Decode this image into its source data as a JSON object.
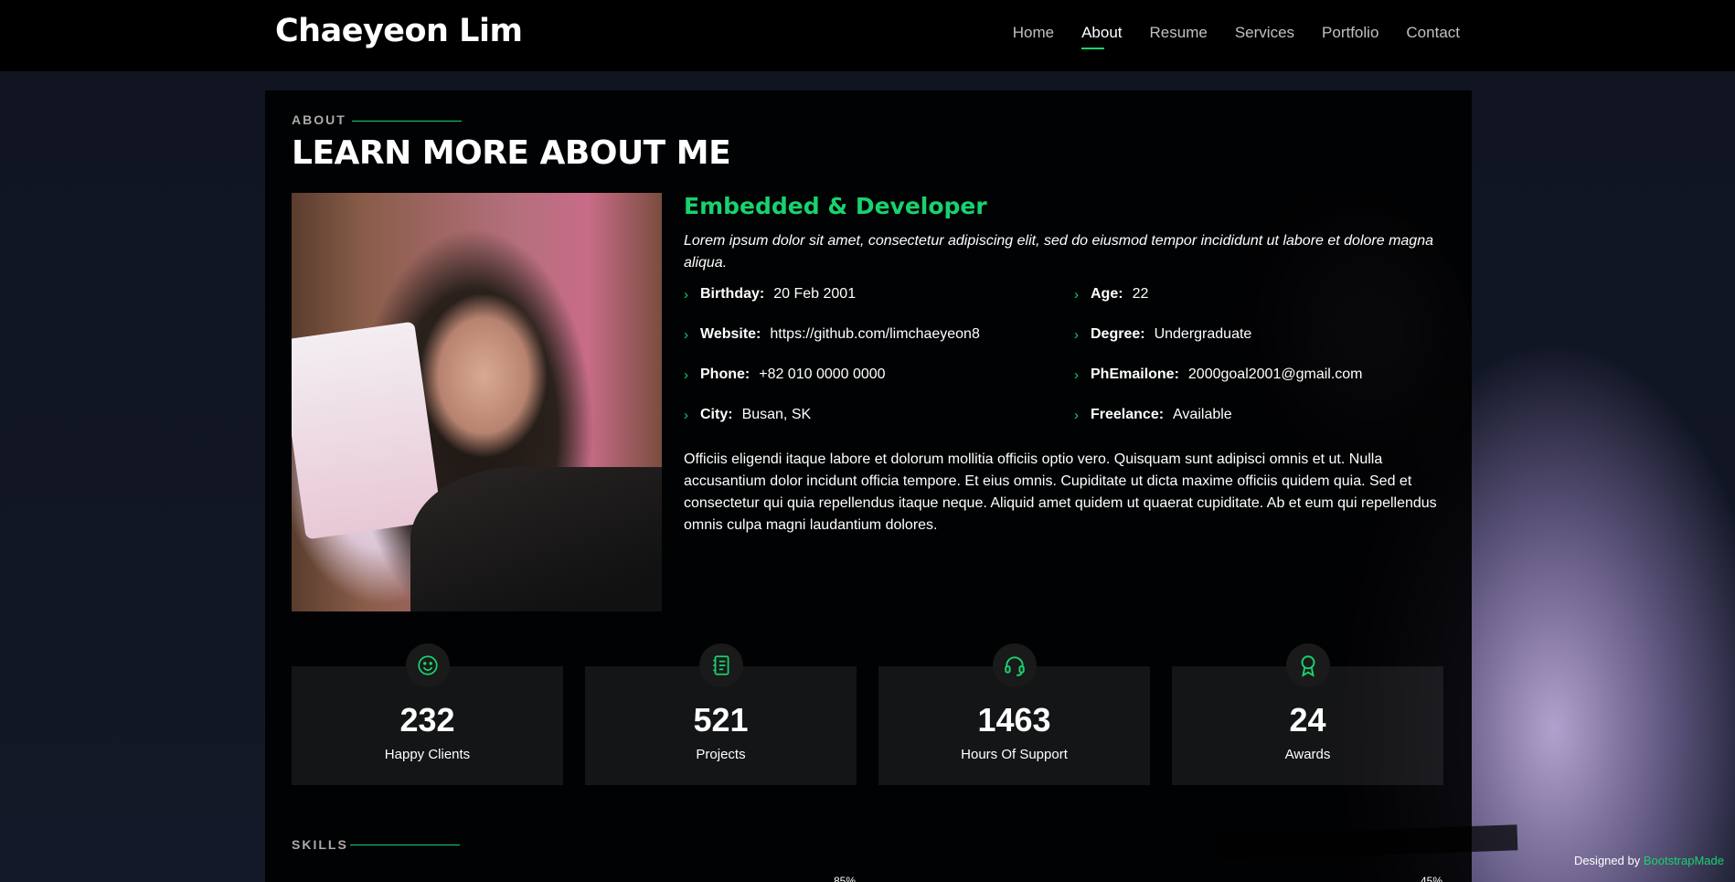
{
  "header": {
    "logo": "Chaeyeon Lim",
    "nav": [
      {
        "label": "Home",
        "active": false
      },
      {
        "label": "About",
        "active": true
      },
      {
        "label": "Resume",
        "active": false
      },
      {
        "label": "Services",
        "active": false
      },
      {
        "label": "Portfolio",
        "active": false
      },
      {
        "label": "Contact",
        "active": false
      }
    ]
  },
  "about": {
    "section_label": "About",
    "title": "LEARN MORE ABOUT ME",
    "role": "Embedded & Developer",
    "lead": "Lorem ipsum dolor sit amet, consectetur adipiscing elit, sed do eiusmod tempor incididunt ut labore et dolore magna aliqua.",
    "facts_left": [
      {
        "key": "Birthday:",
        "value": "20 Feb 2001"
      },
      {
        "key": "Website:",
        "value": "https://github.com/limchaeyeon8"
      },
      {
        "key": "Phone:",
        "value": "+82 010 0000 0000"
      },
      {
        "key": "City:",
        "value": "Busan, SK"
      }
    ],
    "facts_right": [
      {
        "key": "Age:",
        "value": "22"
      },
      {
        "key": "Degree:",
        "value": "Undergraduate"
      },
      {
        "key": "PhEmailone:",
        "value": "2000goal2001@gmail.com"
      },
      {
        "key": "Freelance:",
        "value": "Available"
      }
    ],
    "body": "Officiis eligendi itaque labore et dolorum mollitia officiis optio vero. Quisquam sunt adipisci omnis et ut. Nulla accusantium dolor incidunt officia tempore. Et eius omnis. Cupiditate ut dicta maxime officiis quidem quia. Sed et consectetur qui quia repellendus itaque neque. Aliquid amet quidem ut quaerat cupiditate. Ab et eum qui repellendus omnis culpa magni laudantium dolores."
  },
  "stats": [
    {
      "number": "232",
      "label": "Happy Clients",
      "icon": "smile-icon"
    },
    {
      "number": "521",
      "label": "Projects",
      "icon": "journal-icon"
    },
    {
      "number": "1463",
      "label": "Hours Of Support",
      "icon": "headset-icon"
    },
    {
      "number": "24",
      "label": "Awards",
      "icon": "award-icon"
    }
  ],
  "skills": {
    "section_label": "Skills",
    "left_pct": "85%",
    "right_pct": "45%"
  },
  "footer": {
    "credit_prefix": "Designed by ",
    "credit_link": "BootstrapMade"
  },
  "colors": {
    "accent": "#18d26e",
    "background": "#040404"
  }
}
